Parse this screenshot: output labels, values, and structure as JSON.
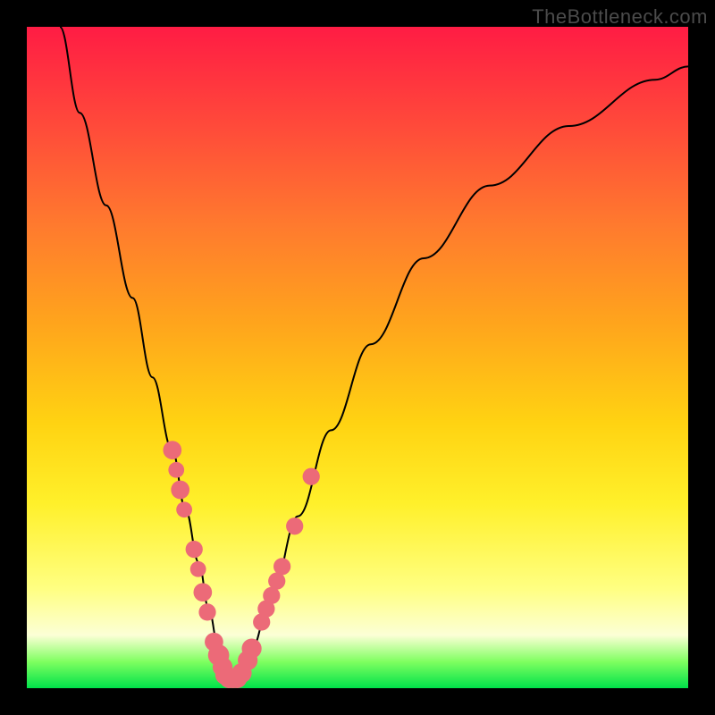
{
  "watermark": "TheBottleneck.com",
  "chart_data": {
    "type": "line",
    "title": "",
    "xlabel": "",
    "ylabel": "",
    "xlim": [
      0,
      100
    ],
    "ylim": [
      0,
      100
    ],
    "series": [
      {
        "name": "curve",
        "x": [
          5,
          8,
          12,
          16,
          19,
          22,
          24,
          26,
          27.5,
          29,
          30.3,
          32,
          34,
          37,
          41,
          46,
          52,
          60,
          70,
          82,
          95,
          100
        ],
        "y": [
          100,
          87,
          73,
          59,
          47,
          36,
          27,
          19,
          12,
          6,
          1.5,
          1.5,
          6,
          14,
          26,
          39,
          52,
          65,
          76,
          85,
          92,
          94
        ]
      }
    ],
    "markers": [
      {
        "x": 22.0,
        "y": 36,
        "r": 1.4
      },
      {
        "x": 22.6,
        "y": 33,
        "r": 1.2
      },
      {
        "x": 23.2,
        "y": 30,
        "r": 1.4
      },
      {
        "x": 23.8,
        "y": 27,
        "r": 1.2
      },
      {
        "x": 25.3,
        "y": 21,
        "r": 1.3
      },
      {
        "x": 25.9,
        "y": 18,
        "r": 1.2
      },
      {
        "x": 26.6,
        "y": 14.5,
        "r": 1.4
      },
      {
        "x": 27.3,
        "y": 11.5,
        "r": 1.3
      },
      {
        "x": 28.3,
        "y": 7.0,
        "r": 1.4
      },
      {
        "x": 29.0,
        "y": 5.0,
        "r": 1.6
      },
      {
        "x": 29.6,
        "y": 3.2,
        "r": 1.5
      },
      {
        "x": 30.0,
        "y": 2.0,
        "r": 1.5
      },
      {
        "x": 30.6,
        "y": 1.5,
        "r": 1.5
      },
      {
        "x": 31.2,
        "y": 1.5,
        "r": 1.5
      },
      {
        "x": 31.8,
        "y": 1.5,
        "r": 1.5
      },
      {
        "x": 32.5,
        "y": 2.3,
        "r": 1.5
      },
      {
        "x": 33.4,
        "y": 4.2,
        "r": 1.5
      },
      {
        "x": 34.0,
        "y": 6.0,
        "r": 1.5
      },
      {
        "x": 35.5,
        "y": 10.0,
        "r": 1.3
      },
      {
        "x": 36.2,
        "y": 12.0,
        "r": 1.3
      },
      {
        "x": 37.0,
        "y": 14.0,
        "r": 1.3
      },
      {
        "x": 37.8,
        "y": 16.2,
        "r": 1.3
      },
      {
        "x": 38.6,
        "y": 18.4,
        "r": 1.3
      },
      {
        "x": 40.5,
        "y": 24.5,
        "r": 1.3
      },
      {
        "x": 43.0,
        "y": 32.0,
        "r": 1.3
      }
    ],
    "marker_color": "#ec6a78",
    "curve_color": "#000000",
    "curve_width": 2
  }
}
